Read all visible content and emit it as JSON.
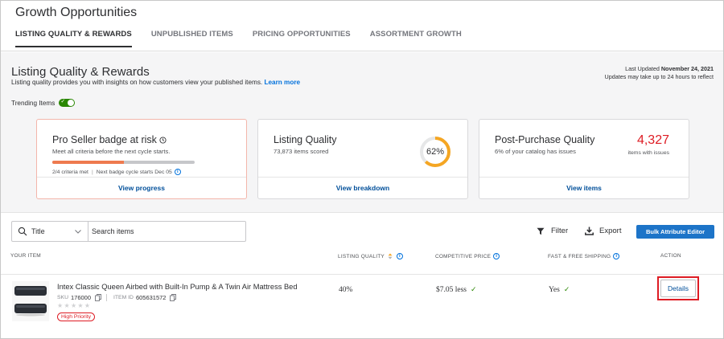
{
  "header": {
    "title": "Growth Opportunities",
    "tabs": [
      {
        "label": "LISTING QUALITY & REWARDS",
        "active": true
      },
      {
        "label": "UNPUBLISHED ITEMS",
        "active": false
      },
      {
        "label": "PRICING OPPORTUNITIES",
        "active": false
      },
      {
        "label": "ASSORTMENT GROWTH",
        "active": false
      }
    ]
  },
  "summary": {
    "title": "Listing Quality & Rewards",
    "description": "Listing quality provides you with insights on how customers view your published items.",
    "learn_more": "Learn more",
    "last_updated_label": "Last Updated",
    "last_updated_date": "November 24, 2021",
    "update_note": "Updates may take up to 24 hours to reflect",
    "trending_label": "Trending Items",
    "trending_on": true
  },
  "cards": {
    "pro_seller": {
      "title": "Pro Seller badge at risk",
      "subtitle": "Meet all criteria before the next cycle starts.",
      "criteria_met": "2/4 criteria met",
      "next_cycle": "Next badge cycle starts Dec 05",
      "progress_fraction": 0.5,
      "link": "View progress"
    },
    "listing_quality": {
      "title": "Listing Quality",
      "subtitle": "73,873 items scored",
      "percent_label": "62%",
      "percent": 62,
      "link": "View breakdown"
    },
    "post_purchase": {
      "title": "Post-Purchase Quality",
      "subtitle": "6% of your catalog has issues",
      "count": "4,327",
      "count_label": "items with issues",
      "link": "View items"
    }
  },
  "toolbar": {
    "search_field": "Title",
    "search_placeholder": "Search items",
    "filter_label": "Filter",
    "export_label": "Export",
    "bulk_label": "Bulk Attribute Editor"
  },
  "table": {
    "columns": [
      "YOUR ITEM",
      "LISTING QUALITY",
      "COMPETITIVE PRICE",
      "FAST & FREE SHIPPING",
      "ACTION"
    ],
    "rows": [
      {
        "title": "Intex Classic Queen Airbed with Built-In Pump & A Twin Air Mattress Bed",
        "sku_label": "SKU",
        "sku": "176000",
        "item_id_label": "ITEM ID",
        "item_id": "605631572",
        "rating_stars": 0,
        "priority": "High Priority",
        "listing_quality": "40%",
        "competitive_price": "$7.05 less",
        "shipping": "Yes",
        "action": "Details"
      }
    ]
  },
  "colors": {
    "accent_blue": "#0071dc",
    "link_blue": "#004f9a",
    "success_green": "#2a8703",
    "alert_red": "#de1c24",
    "progress_orange": "#ee7a4f",
    "donut_orange": "#f5a623"
  }
}
